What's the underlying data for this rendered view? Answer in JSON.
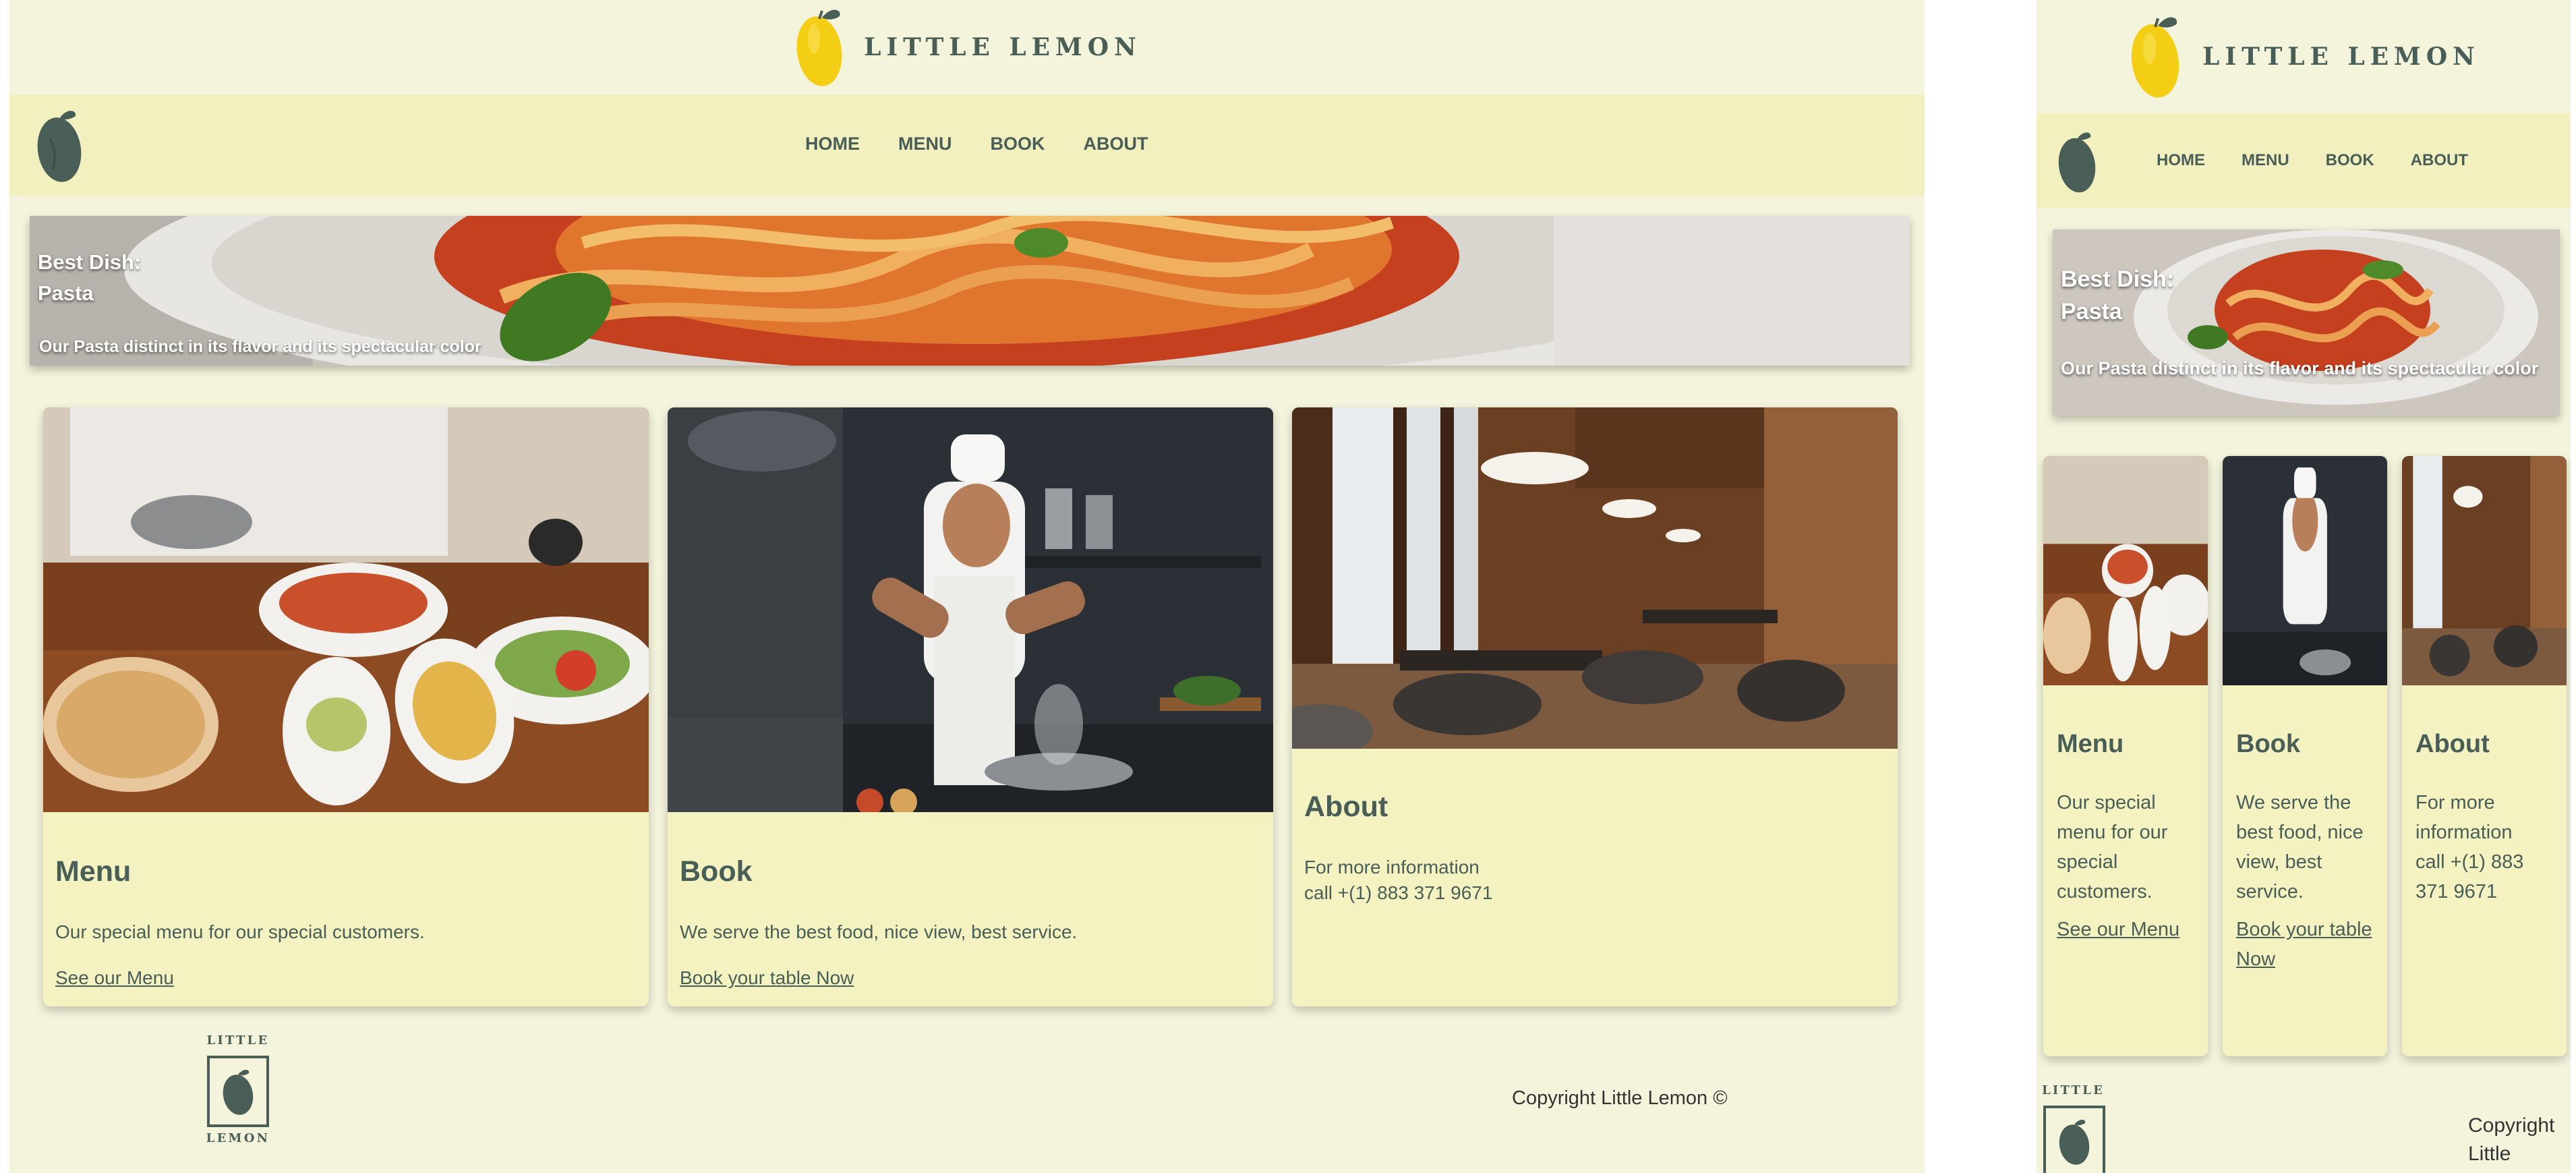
{
  "brand": {
    "name": "LITTLE LEMON"
  },
  "nav": {
    "items": [
      {
        "label": "HOME"
      },
      {
        "label": "MENU"
      },
      {
        "label": "BOOK"
      },
      {
        "label": "ABOUT"
      }
    ]
  },
  "hero": {
    "title_line1": "Best Dish:",
    "title_line2": "Pasta",
    "caption": "Our Pasta distinct in its flavor and its spectacular color"
  },
  "cards": [
    {
      "title": "Menu",
      "text": "Our special menu for our special customers.",
      "link": "See our Menu"
    },
    {
      "title": "Book",
      "text": "We serve the best food, nice view, best service.",
      "link": "Book your table Now"
    },
    {
      "title": "About",
      "text_line1": "For more information",
      "text_line2": "call +(1) 883 371 9671"
    }
  ],
  "footer": {
    "logo_top": "LITTLE",
    "logo_bottom": "LEMON",
    "copyright": "Copyright Little Lemon ©"
  },
  "colors": {
    "background": "#f4f4dc",
    "nav_band": "#f3f0c0",
    "card": "#f3f2c0",
    "text": "#495e57",
    "lemon": "#f4ce14"
  },
  "icons": [
    "lemon-logo-icon",
    "dark-lemon-icon",
    "small-lemon-logo-icon"
  ]
}
